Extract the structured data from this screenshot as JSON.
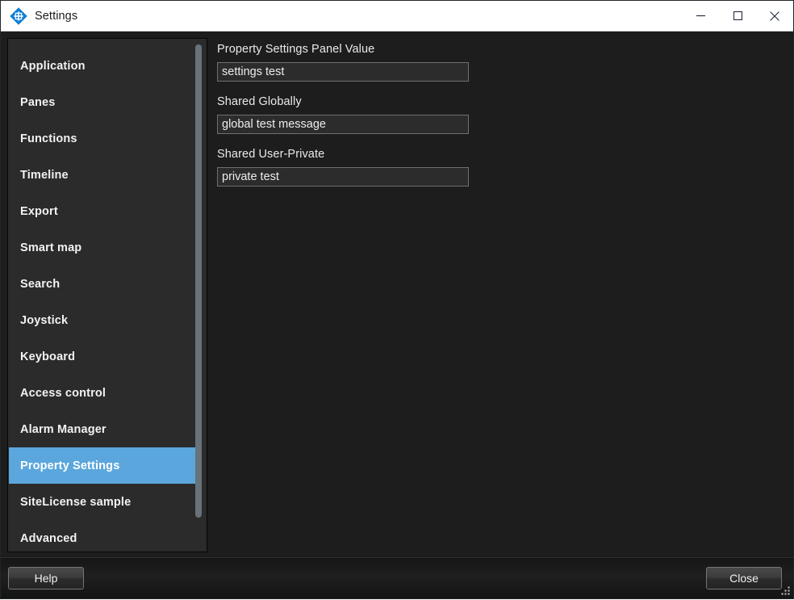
{
  "window": {
    "title": "Settings",
    "app_icon": "xprotect-diamond-icon",
    "controls": {
      "minimize": "minimize-icon",
      "maximize": "maximize-icon",
      "close": "close-icon"
    }
  },
  "sidebar": {
    "scrollbar": "vertical-scrollbar",
    "selected": "Property Settings",
    "items": [
      {
        "label": "Application",
        "selected": false
      },
      {
        "label": "Panes",
        "selected": false
      },
      {
        "label": "Functions",
        "selected": false
      },
      {
        "label": "Timeline",
        "selected": false
      },
      {
        "label": "Export",
        "selected": false
      },
      {
        "label": "Smart map",
        "selected": false
      },
      {
        "label": "Search",
        "selected": false
      },
      {
        "label": "Joystick",
        "selected": false
      },
      {
        "label": "Keyboard",
        "selected": false
      },
      {
        "label": "Access control",
        "selected": false
      },
      {
        "label": "Alarm Manager",
        "selected": false
      },
      {
        "label": "Property Settings",
        "selected": true
      },
      {
        "label": "SiteLicense sample",
        "selected": false
      },
      {
        "label": "Advanced",
        "selected": false
      }
    ]
  },
  "pane": {
    "fields": [
      {
        "label": "Property Settings Panel Value",
        "value": "settings test",
        "placeholder": ""
      },
      {
        "label": "Shared Globally",
        "value": "global test message",
        "placeholder": ""
      },
      {
        "label": "Shared User-Private",
        "value": "private test",
        "placeholder": ""
      }
    ]
  },
  "footer": {
    "help_label": "Help",
    "close_label": "Close",
    "resize_grip": "resize-grip-icon"
  },
  "colors": {
    "accent": "#5ba7dd",
    "window_bg": "#1d1d1d",
    "sidebar_bg": "#2b2b2b",
    "titlebar_bg": "#ffffff",
    "input_bg": "#2c2c2c",
    "input_border": "#6f6f6f",
    "scrollbar_thumb": "#68727a",
    "text": "#f0f0f0"
  }
}
